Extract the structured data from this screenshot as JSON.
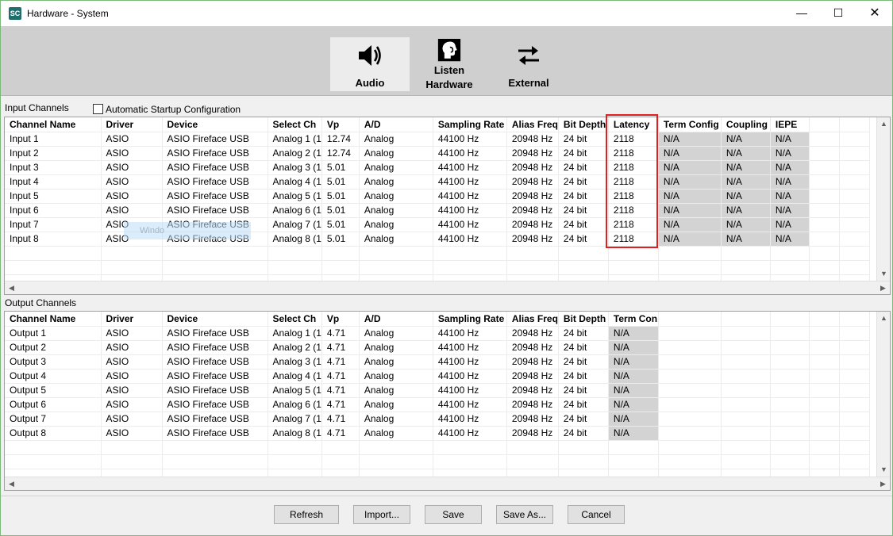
{
  "window": {
    "title": "Hardware - System",
    "app_icon": "SC"
  },
  "toolbar": {
    "audio_label": "Audio",
    "listen_label_1": "Listen",
    "listen_label_2": "Hardware",
    "external_label": "External"
  },
  "input_section": {
    "label": "Input Channels",
    "auto_startup_label": "Automatic Startup Configuration",
    "auto_startup_checked": false,
    "headers": [
      "Channel Name",
      "Driver",
      "Device",
      "Select Ch",
      "Vp",
      "A/D",
      "Sampling Rate",
      "Alias Freq",
      "Bit Depth",
      "Latency",
      "Term Config",
      "Coupling",
      "IEPE"
    ],
    "rows": [
      [
        "Input 1",
        "ASIO",
        "ASIO Fireface USB",
        "Analog 1 (1",
        "12.74",
        "Analog",
        "44100 Hz",
        "20948 Hz",
        "24 bit",
        "2118",
        "N/A",
        "N/A",
        "N/A"
      ],
      [
        "Input 2",
        "ASIO",
        "ASIO Fireface USB",
        "Analog 2 (1",
        "12.74",
        "Analog",
        "44100 Hz",
        "20948 Hz",
        "24 bit",
        "2118",
        "N/A",
        "N/A",
        "N/A"
      ],
      [
        "Input 3",
        "ASIO",
        "ASIO Fireface USB",
        "Analog 3 (1",
        "5.01",
        "Analog",
        "44100 Hz",
        "20948 Hz",
        "24 bit",
        "2118",
        "N/A",
        "N/A",
        "N/A"
      ],
      [
        "Input 4",
        "ASIO",
        "ASIO Fireface USB",
        "Analog 4 (1",
        "5.01",
        "Analog",
        "44100 Hz",
        "20948 Hz",
        "24 bit",
        "2118",
        "N/A",
        "N/A",
        "N/A"
      ],
      [
        "Input 5",
        "ASIO",
        "ASIO Fireface USB",
        "Analog 5 (1",
        "5.01",
        "Analog",
        "44100 Hz",
        "20948 Hz",
        "24 bit",
        "2118",
        "N/A",
        "N/A",
        "N/A"
      ],
      [
        "Input 6",
        "ASIO",
        "ASIO Fireface USB",
        "Analog 6 (1",
        "5.01",
        "Analog",
        "44100 Hz",
        "20948 Hz",
        "24 bit",
        "2118",
        "N/A",
        "N/A",
        "N/A"
      ],
      [
        "Input 7",
        "ASIO",
        "ASIO Fireface USB",
        "Analog 7 (1",
        "5.01",
        "Analog",
        "44100 Hz",
        "20948 Hz",
        "24 bit",
        "2118",
        "N/A",
        "N/A",
        "N/A"
      ],
      [
        "Input 8",
        "ASIO",
        "ASIO Fireface USB",
        "Analog 8 (1",
        "5.01",
        "Analog",
        "44100 Hz",
        "20948 Hz",
        "24 bit",
        "2118",
        "N/A",
        "N/A",
        "N/A"
      ]
    ],
    "ghost_text": "Windo"
  },
  "output_section": {
    "label": "Output Channels",
    "headers": [
      "Channel Name",
      "Driver",
      "Device",
      "Select Ch",
      "Vp",
      "A/D",
      "Sampling Rate",
      "Alias Freq",
      "Bit Depth",
      "Term Con"
    ],
    "rows": [
      [
        "Output 1",
        "ASIO",
        "ASIO Fireface USB",
        "Analog 1 (1",
        "4.71",
        "Analog",
        "44100 Hz",
        "20948 Hz",
        "24 bit",
        "N/A"
      ],
      [
        "Output 2",
        "ASIO",
        "ASIO Fireface USB",
        "Analog 2 (1",
        "4.71",
        "Analog",
        "44100 Hz",
        "20948 Hz",
        "24 bit",
        "N/A"
      ],
      [
        "Output 3",
        "ASIO",
        "ASIO Fireface USB",
        "Analog 3 (1",
        "4.71",
        "Analog",
        "44100 Hz",
        "20948 Hz",
        "24 bit",
        "N/A"
      ],
      [
        "Output 4",
        "ASIO",
        "ASIO Fireface USB",
        "Analog 4 (1",
        "4.71",
        "Analog",
        "44100 Hz",
        "20948 Hz",
        "24 bit",
        "N/A"
      ],
      [
        "Output 5",
        "ASIO",
        "ASIO Fireface USB",
        "Analog 5 (1",
        "4.71",
        "Analog",
        "44100 Hz",
        "20948 Hz",
        "24 bit",
        "N/A"
      ],
      [
        "Output 6",
        "ASIO",
        "ASIO Fireface USB",
        "Analog 6 (1",
        "4.71",
        "Analog",
        "44100 Hz",
        "20948 Hz",
        "24 bit",
        "N/A"
      ],
      [
        "Output 7",
        "ASIO",
        "ASIO Fireface USB",
        "Analog 7 (1",
        "4.71",
        "Analog",
        "44100 Hz",
        "20948 Hz",
        "24 bit",
        "N/A"
      ],
      [
        "Output 8",
        "ASIO",
        "ASIO Fireface USB",
        "Analog 8 (1",
        "4.71",
        "Analog",
        "44100 Hz",
        "20948 Hz",
        "24 bit",
        "N/A"
      ]
    ]
  },
  "buttons": {
    "refresh": "Refresh",
    "import": "Import...",
    "save": "Save",
    "save_as": "Save As...",
    "cancel": "Cancel"
  },
  "colors": {
    "highlight_border": "#e02020",
    "na_cell_bg": "#d3d3d3",
    "toolbar_bg": "#cfcfcf"
  }
}
